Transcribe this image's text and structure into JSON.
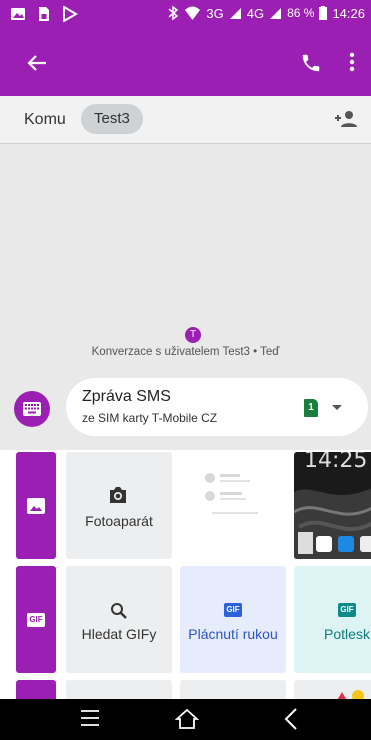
{
  "status_bar": {
    "network": "3G",
    "network2": "4G",
    "battery": "86 %",
    "time": "14:26"
  },
  "app_bar": {
    "icons": [
      "back-arrow-icon",
      "phone-icon",
      "more-vert-icon"
    ]
  },
  "recipient": {
    "label": "Komu",
    "chip": "Test3"
  },
  "conversation": {
    "avatar_letter": "T",
    "info": "Konverzace s uživatelem Test3 • Teď"
  },
  "compose": {
    "title": "Zpráva SMS",
    "subtitle": "ze SIM karty T-Mobile CZ",
    "sim_number": "1"
  },
  "attachments": {
    "camera_label": "Fotoaparát",
    "search_gif_label": "Hledat GIFy",
    "gif1_label": "Plácnutí rukou",
    "gif2_label": "Potlesk",
    "gif_badge": "GIF",
    "photo_clock": "14:25"
  },
  "colors": {
    "accent": "#9c1fb4",
    "sim_green": "#1a7f3c"
  }
}
